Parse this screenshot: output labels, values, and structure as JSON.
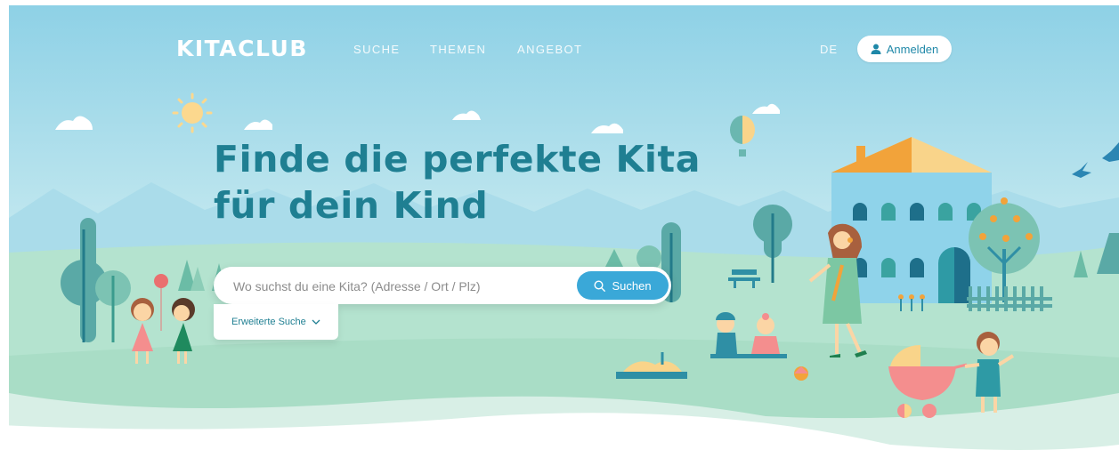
{
  "brand": {
    "logo_text": "KITACLUB"
  },
  "nav": {
    "items": [
      {
        "label": "SUCHE"
      },
      {
        "label": "THEMEN"
      },
      {
        "label": "ANGEBOT"
      }
    ],
    "language": "DE",
    "login_label": "Anmelden"
  },
  "hero": {
    "headline_line1": "Finde die perfekte Kita",
    "headline_line2": "für dein Kind"
  },
  "search": {
    "placeholder": "Wo suchst du eine Kita? (Adresse / Ort / Plz)",
    "value": "",
    "button_label": "Suchen",
    "advanced_label": "Erweiterte Suche"
  },
  "colors": {
    "sky": "#8fd3e6",
    "meadow": "#b3e2cf",
    "headline": "#1f7f92",
    "button": "#3aa8d8",
    "roof": "#f2a33a",
    "house": "#8fd3ea"
  },
  "icons": {
    "login": "user-icon",
    "search": "search-icon",
    "advanced": "chevron-down-icon"
  }
}
